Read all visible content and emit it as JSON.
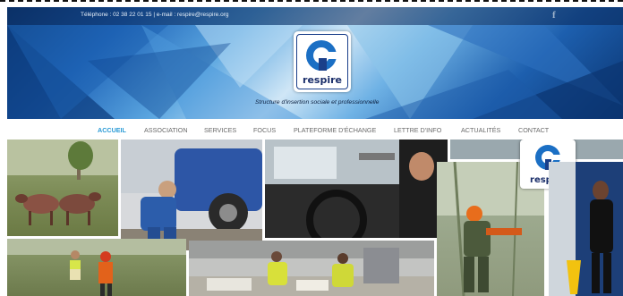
{
  "header": {
    "contact_line": "Téléphone : 02 38 22 01 15 | e-mail : respire@respire.org",
    "facebook_icon": "f",
    "logo_text": "respire",
    "tagline": "Structure d'insertion sociale et professionnelle"
  },
  "nav": {
    "items": [
      "ACCUEIL",
      "ASSOCIATION",
      "SERVICES",
      "FOCUS",
      "PLATEFORME D'ÉCHANGE",
      "LETTRE D'INFO",
      "ACTUALITÉS",
      "CONTACT"
    ],
    "active": "ACCUEIL"
  },
  "mosaic": {
    "badge_text": "respire",
    "photos": [
      "sheep-photo",
      "mechanic-photo",
      "car-interior-photo",
      "car-window-photo",
      "lumber-worker-photo",
      "cleaner-photo",
      "field-workers-photo",
      "sorting-workers-photo"
    ]
  },
  "colors": {
    "accent": "#2b9bd6",
    "nav_text": "#6a6a6a",
    "logo_blue": "#1a3f8a"
  }
}
